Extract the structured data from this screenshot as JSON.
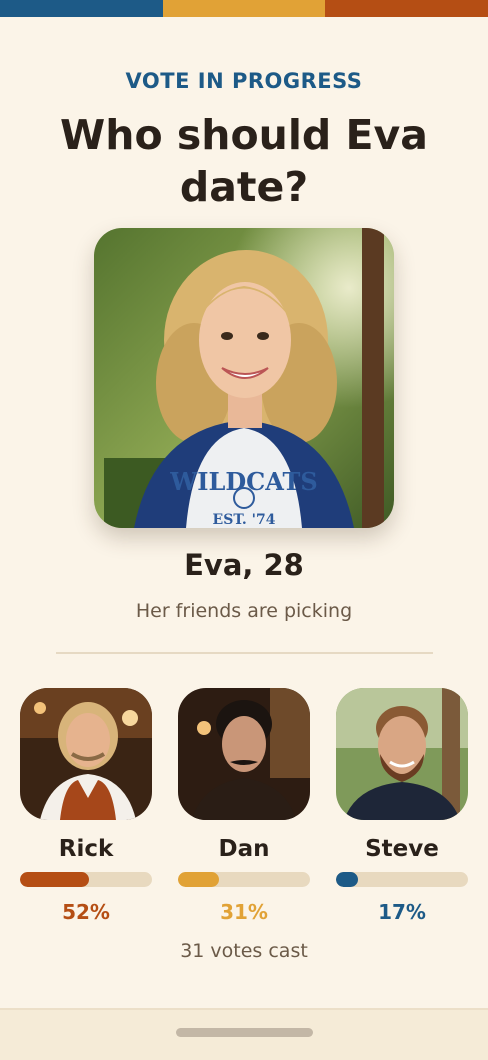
{
  "header": {
    "eyebrow": "VOTE IN PROGRESS",
    "title": "Who should Eva date?"
  },
  "profile": {
    "name_age": "Eva, 28",
    "subtitle": "Her friends are picking",
    "shirt_text_line1": "WILDCATS",
    "shirt_text_line2": "EST. '74"
  },
  "candidates": [
    {
      "name": "Rick",
      "percent_label": "52%",
      "percent": 52,
      "color": "#b54e14"
    },
    {
      "name": "Dan",
      "percent_label": "31%",
      "percent": 31,
      "color": "#e1a236"
    },
    {
      "name": "Steve",
      "percent_label": "17%",
      "percent": 17,
      "color": "#1d5a87"
    }
  ],
  "votes_cast": "31 votes cast",
  "colors": {
    "blue": "#1d5a87",
    "gold": "#e1a236",
    "rust": "#b54e14",
    "background": "#fbf4e8"
  }
}
